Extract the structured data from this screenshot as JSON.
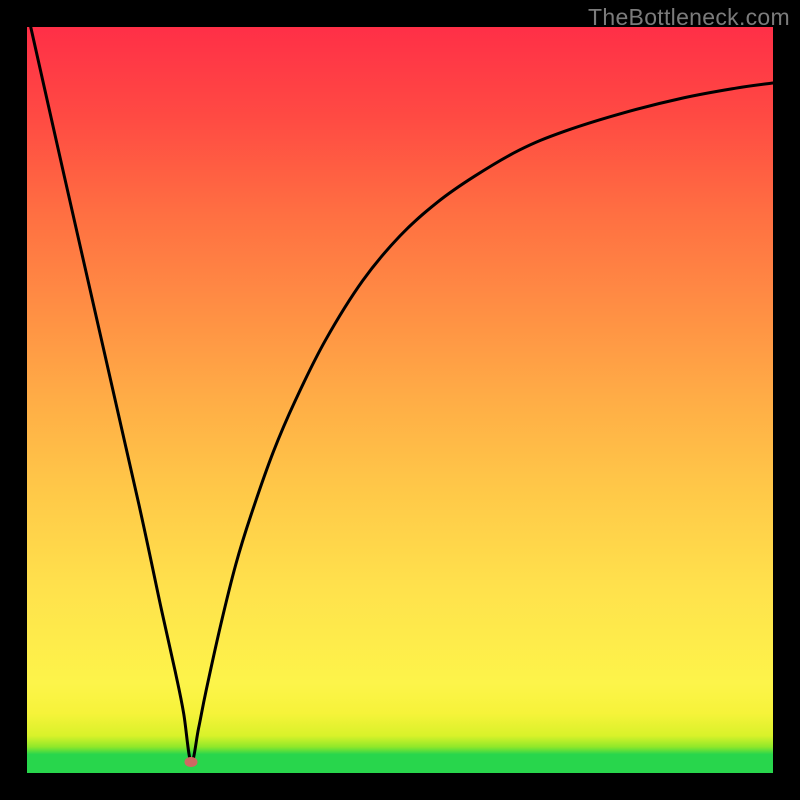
{
  "watermark": "TheBottleneck.com",
  "colors": {
    "frame": "#000000",
    "curve": "#000000",
    "marker": "#cf6862",
    "gradient_top": "#ff2f47",
    "gradient_bottom": "#28d64c"
  },
  "chart_data": {
    "type": "line",
    "title": "",
    "xlabel": "",
    "ylabel": "",
    "xlim": [
      0,
      100
    ],
    "ylim": [
      0,
      100
    ],
    "grid": false,
    "legend": false,
    "annotations": [
      {
        "type": "marker",
        "x": 22,
        "y": 1.5,
        "shape": "ellipse",
        "color": "#cf6862"
      }
    ],
    "series": [
      {
        "name": "curve",
        "color": "#000000",
        "x": [
          0.5,
          5,
          10,
          15,
          18,
          20,
          21,
          22,
          23,
          24,
          26,
          28,
          30,
          33,
          36,
          40,
          45,
          50,
          55,
          60,
          66,
          72,
          80,
          88,
          95,
          100
        ],
        "y": [
          100,
          80,
          58,
          36,
          22,
          13,
          8,
          1.5,
          6,
          11,
          20,
          28,
          34.5,
          43,
          50,
          58,
          66,
          72,
          76.5,
          80,
          83.5,
          86,
          88.5,
          90.5,
          91.8,
          92.5
        ]
      }
    ]
  }
}
